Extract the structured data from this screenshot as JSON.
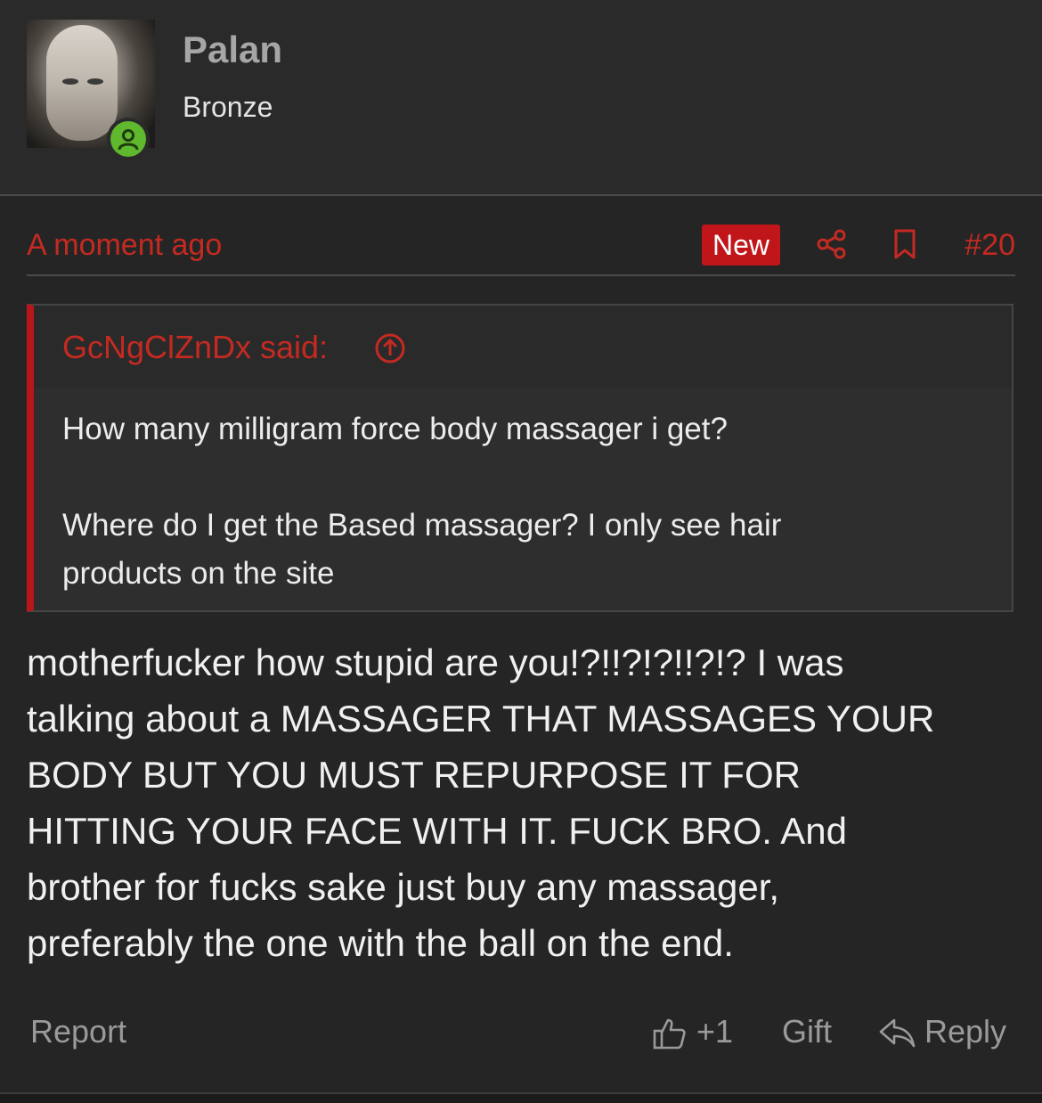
{
  "user": {
    "name": "Palan",
    "title": "Bronze",
    "status": "online"
  },
  "post": {
    "timestamp": "A moment ago",
    "badge": "New",
    "number": "#20",
    "quote": {
      "author_line": "GcNgClZnDx said:",
      "lines": [
        "How many milligram force body massager i get?",
        "Where do I get the Based massager? I only see hair",
        "products on the site"
      ]
    },
    "message_lines": [
      "motherfucker how stupid are you!?!!?!?!!?!? I was",
      "talking about a MASSAGER THAT MASSAGES YOUR",
      "BODY BUT YOU MUST REPURPOSE IT FOR",
      "HITTING YOUR FACE WITH IT. FUCK BRO. And",
      "brother for fucks sake just buy any massager,",
      "preferably the one with the ball on the end."
    ]
  },
  "actions": {
    "report": "Report",
    "like_count": "+1",
    "gift": "Gift",
    "reply": "Reply"
  },
  "colors": {
    "accent_red": "#c42a22",
    "badge_red": "#c0161a",
    "online_green": "#5fb82e",
    "background": "#252525"
  },
  "icons": [
    "share-icon",
    "bookmark-icon",
    "arrow-up-circle-icon",
    "thumbs-up-icon",
    "reply-icon",
    "user-icon"
  ]
}
